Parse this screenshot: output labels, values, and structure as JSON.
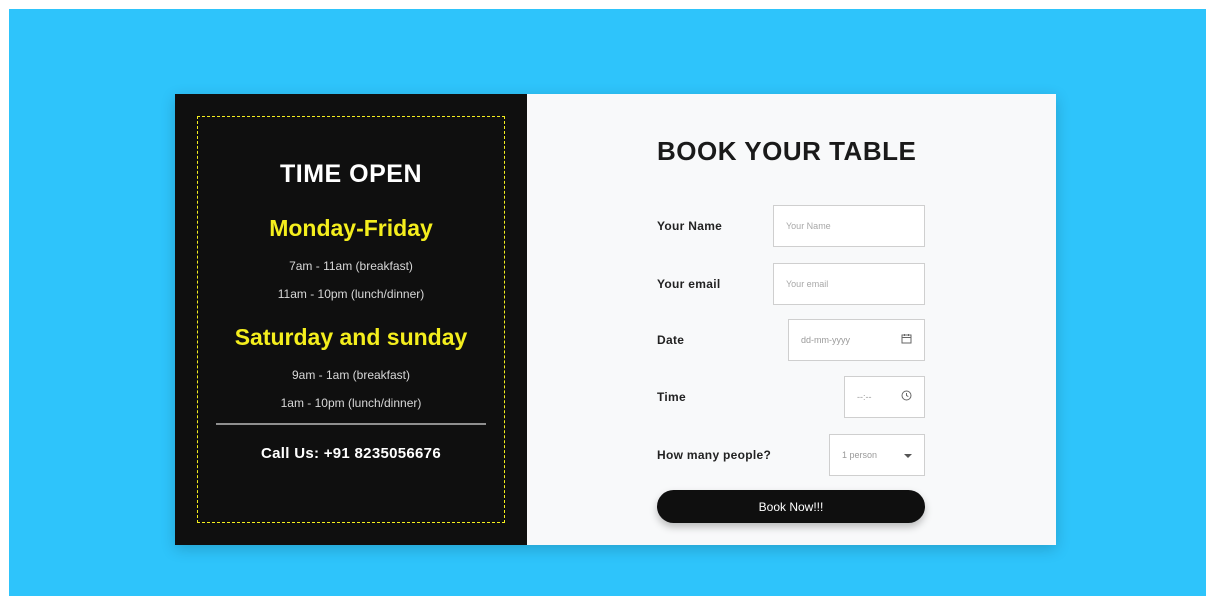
{
  "hours": {
    "title": "TIME OPEN",
    "weekday": {
      "label": "Monday-Friday",
      "slots": [
        "7am - 11am (breakfast)",
        "11am - 10pm (lunch/dinner)"
      ]
    },
    "weekend": {
      "label": "Saturday and sunday",
      "slots": [
        "9am - 1am (breakfast)",
        "1am - 10pm (lunch/dinner)"
      ]
    },
    "call": "Call Us: +91 8235056676"
  },
  "booking": {
    "title": "BOOK YOUR TABLE",
    "name": {
      "label": "Your Name",
      "placeholder": "Your Name"
    },
    "email": {
      "label": "Your email",
      "placeholder": "Your email"
    },
    "date": {
      "label": "Date",
      "placeholder": "dd-mm-yyyy"
    },
    "time": {
      "label": "Time",
      "placeholder": "--:-- "
    },
    "people": {
      "label": "How many people?",
      "value": "1 person"
    },
    "submit": "Book Now!!!"
  },
  "colors": {
    "background": "#2ec4fb",
    "panel_dark": "#0f0f0f",
    "accent_yellow": "#f4ee1d",
    "panel_light": "#f8f9fa"
  }
}
